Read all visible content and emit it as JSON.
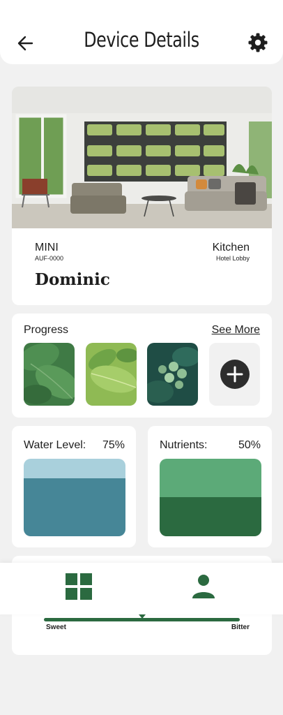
{
  "header": {
    "title": "Device Details",
    "back_icon": "arrow-left-icon",
    "settings_icon": "gear-icon"
  },
  "device": {
    "model": "MINI",
    "serial": "AUF-0000",
    "room": "Kitchen",
    "location": "Hotel Lobby",
    "name": "Dominic"
  },
  "progress": {
    "title": "Progress",
    "see_more": "See More",
    "add_icon": "plus-icon"
  },
  "water": {
    "label": "Water Level:",
    "value": "75%",
    "level": 0.75,
    "empty_color": "#a9d0dc",
    "fill_color": "#468697"
  },
  "nutrients": {
    "label": "Nutrients:",
    "value": "50%",
    "level": 0.5,
    "empty_color": "#5caa78",
    "fill_color": "#2b6a40"
  },
  "taste": {
    "left_label": "Sweet",
    "right_label": "Bitter",
    "position": 0.5
  },
  "nav": {
    "items": [
      {
        "icon": "grid-icon"
      },
      {
        "icon": "user-icon"
      }
    ]
  },
  "colors": {
    "brand": "#2b6a40",
    "water": "#468697",
    "background": "#f1f1f1"
  }
}
